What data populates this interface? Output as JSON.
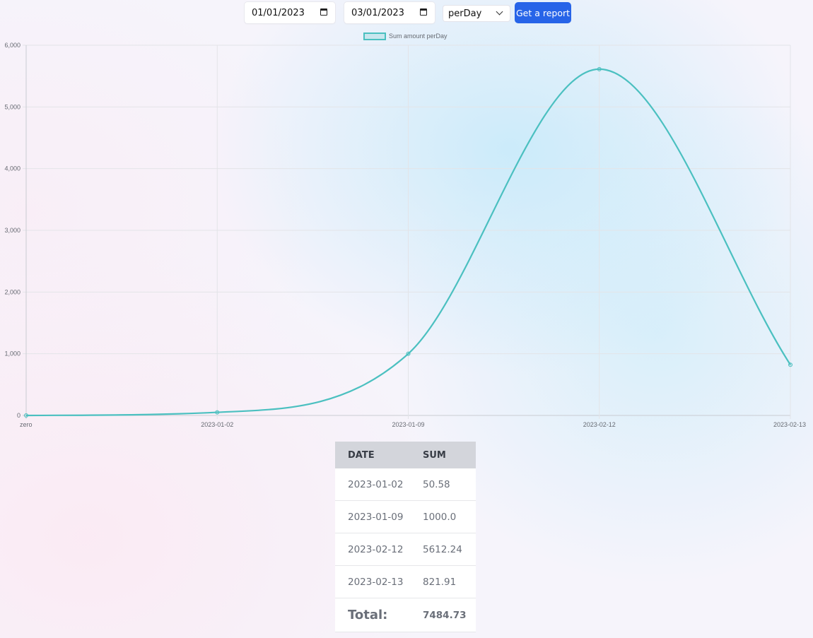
{
  "toolbar": {
    "date_from": "01/01/2023",
    "date_to": "03/01/2023",
    "period": "perDay",
    "report_button": "Get a report"
  },
  "colors": {
    "accent": "#2764e8",
    "series_line": "#4bc0c0",
    "series_fill": "rgba(75,192,192,0.2)"
  },
  "chart_data": {
    "type": "line",
    "categories": [
      "zero",
      "2023-01-02",
      "2023-01-09",
      "2023-02-12",
      "2023-02-13"
    ],
    "series": [
      {
        "name": "Sum amount perDay",
        "values": [
          0,
          50.58,
          1000.0,
          5612.24,
          821.91
        ]
      }
    ],
    "ylim": [
      0,
      6000
    ],
    "yticks": [
      "0",
      "1,000",
      "2,000",
      "3,000",
      "4,000",
      "5,000",
      "6,000"
    ],
    "grid": true,
    "legend": "top-center"
  },
  "table": {
    "headers": [
      "DATE",
      "SUM"
    ],
    "rows": [
      [
        "2023-01-02",
        "50.58"
      ],
      [
        "2023-01-09",
        "1000.0"
      ],
      [
        "2023-02-12",
        "5612.24"
      ],
      [
        "2023-02-13",
        "821.91"
      ]
    ],
    "total_label": "Total:",
    "total_value": "7484.73"
  }
}
